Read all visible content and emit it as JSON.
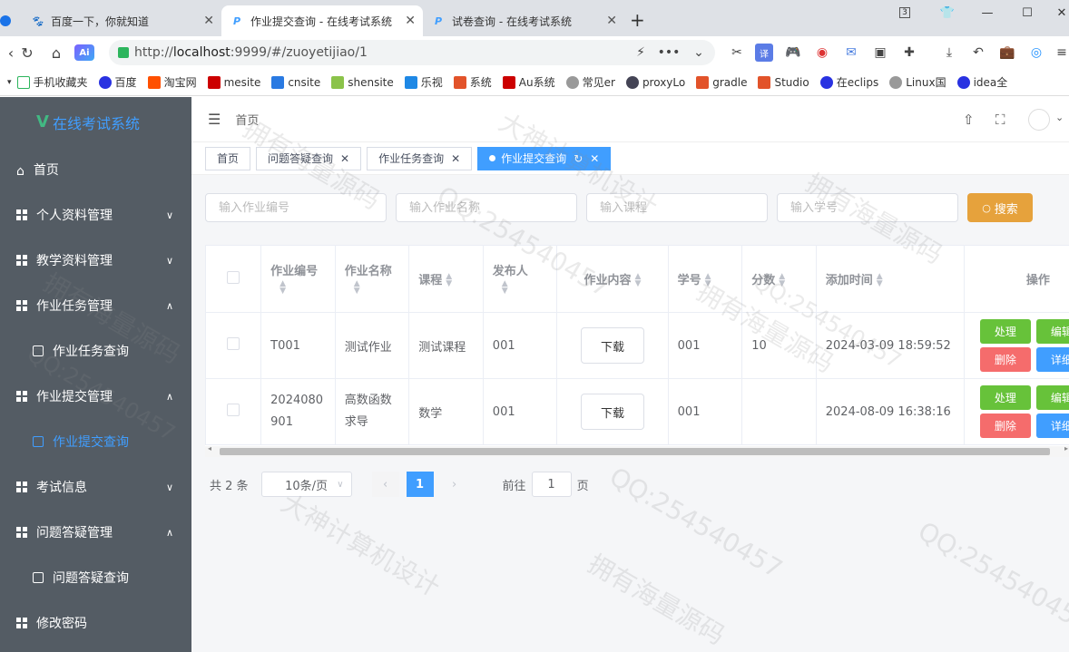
{
  "browser": {
    "tabs": [
      {
        "title": "百度一下，你就知道",
        "active": false
      },
      {
        "title": "作业提交查询 - 在线考试系统",
        "active": true
      },
      {
        "title": "试卷查询 - 在线考试系统",
        "active": false
      }
    ],
    "tab_count": "3",
    "url_prefix": "http://",
    "url_host": "localhost",
    "url_rest": ":9999/#/zuoyetijiao/1",
    "bookmarks": [
      "手机收藏夹",
      "百度",
      "淘宝网",
      "mesite",
      "cnsite",
      "shensite",
      "乐视",
      "系统",
      "Au系统",
      "常见er",
      "proxyLo",
      "gradle",
      "Studio",
      "在eclips",
      "Linux国",
      "idea全"
    ]
  },
  "app": {
    "title": "在线考试系统",
    "logo_letter": "V",
    "breadcrumb": "首页"
  },
  "sidebar": {
    "items": [
      {
        "label": "首页",
        "arrow": ""
      },
      {
        "label": "个人资料管理",
        "arrow": "∨"
      },
      {
        "label": "教学资料管理",
        "arrow": "∨"
      },
      {
        "label": "作业任务管理",
        "arrow": "∧"
      },
      {
        "label": "作业任务查询",
        "arrow": ""
      },
      {
        "label": "作业提交管理",
        "arrow": "∧"
      },
      {
        "label": "作业提交查询",
        "arrow": ""
      },
      {
        "label": "考试信息",
        "arrow": "∨"
      },
      {
        "label": "问题答疑管理",
        "arrow": "∧"
      },
      {
        "label": "问题答疑查询",
        "arrow": ""
      },
      {
        "label": "修改密码",
        "arrow": ""
      }
    ]
  },
  "tags": [
    {
      "label": "首页"
    },
    {
      "label": "问题答疑查询"
    },
    {
      "label": "作业任务查询"
    },
    {
      "label": "作业提交查询"
    }
  ],
  "search": {
    "placeholders": [
      "输入作业编号",
      "输入作业名称",
      "输入课程",
      "输入学号"
    ],
    "button": "搜索"
  },
  "table": {
    "headers": [
      "作业编号",
      "作业名称",
      "课程",
      "发布人",
      "作业内容",
      "学号",
      "分数",
      "添加时间",
      "操作"
    ],
    "rows": [
      {
        "code": "T001",
        "name": "测试作业",
        "course": "测试课程",
        "publisher": "001",
        "content": "下载",
        "student": "001",
        "score": "10",
        "time": "2024-03-09 18:59:52"
      },
      {
        "code": "2024080901",
        "name": "高数函数求导",
        "course": "数学",
        "publisher": "001",
        "content": "下载",
        "student": "001",
        "score": "",
        "time": "2024-08-09 16:38:16"
      }
    ],
    "actions": {
      "handle": "处理",
      "edit": "编辑",
      "delete": "删除",
      "detail": "详细"
    }
  },
  "pager": {
    "total": "共 2 条",
    "size": "10条/页",
    "current": "1",
    "goto_label": "前往",
    "goto_value": "1",
    "page_unit": "页"
  },
  "watermarks": [
    "拥有海量源码",
    "QQ:254540457",
    "大神计算机设计"
  ]
}
